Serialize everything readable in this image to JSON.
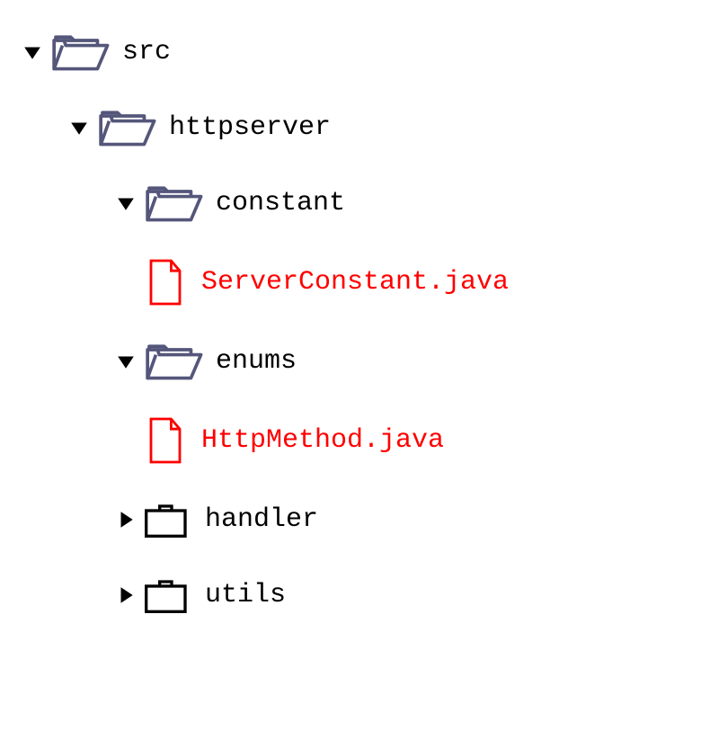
{
  "tree": {
    "rows": [
      {
        "indent": 0,
        "type": "folder-open",
        "expand": "down",
        "label": "src",
        "color": "normal"
      },
      {
        "indent": 1,
        "type": "folder-open",
        "expand": "down",
        "label": "httpserver",
        "color": "normal"
      },
      {
        "indent": 2,
        "type": "folder-open",
        "expand": "down",
        "label": "constant",
        "color": "normal"
      },
      {
        "indent": 2,
        "type": "file",
        "expand": "none",
        "label": "ServerConstant.java",
        "color": "file"
      },
      {
        "indent": 2,
        "type": "folder-open",
        "expand": "down",
        "label": "enums",
        "color": "normal"
      },
      {
        "indent": 2,
        "type": "file",
        "expand": "none",
        "label": "HttpMethod.java",
        "color": "file"
      },
      {
        "indent": 2,
        "type": "folder-closed",
        "expand": "right",
        "label": "handler",
        "color": "normal"
      },
      {
        "indent": 2,
        "type": "folder-closed",
        "expand": "right",
        "label": "utils",
        "color": "normal"
      }
    ]
  },
  "colors": {
    "folderOpen": "#54567a",
    "folderClosed": "#000000",
    "file": "#ff0000",
    "chevron": "#000000"
  }
}
